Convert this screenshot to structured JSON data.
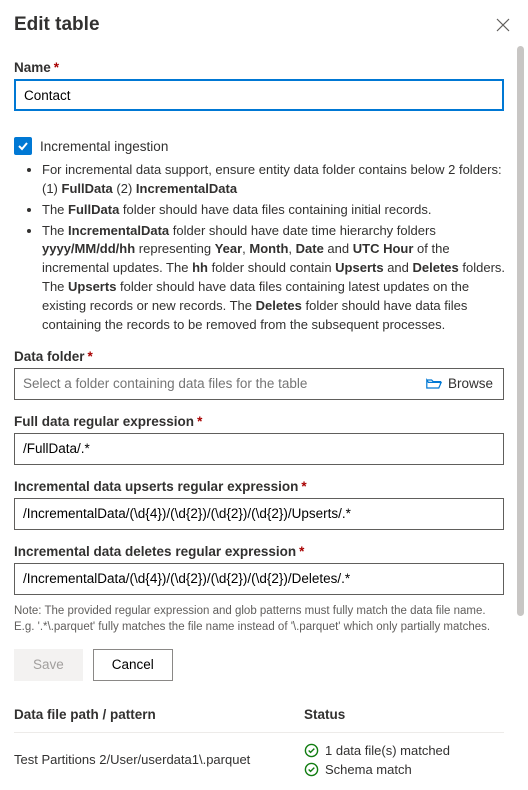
{
  "header": {
    "title": "Edit table"
  },
  "name": {
    "label": "Name",
    "value": "Contact"
  },
  "incremental": {
    "label": "Incremental ingestion",
    "bullets": [
      "For incremental data support, ensure entity data folder contains below 2 folders: (1) <b>FullData</b> (2) <b>IncrementalData</b>",
      "The <b>FullData</b> folder should have data files containing initial records.",
      "The <b>IncrementalData</b> folder should have date time hierarchy folders <b>yyyy/MM/dd/hh</b> representing <b>Year</b>, <b>Month</b>, <b>Date</b> and <b>UTC Hour</b> of the incremental updates. The <b>hh</b> folder should contain <b>Upserts</b> and <b>Deletes</b> folders. The <b>Upserts</b> folder should have data files containing latest updates on the existing records or new records. The <b>Deletes</b> folder should have data files containing the records to be removed from the subsequent processes."
    ]
  },
  "dataFolder": {
    "label": "Data folder",
    "placeholder": "Select a folder containing data files for the table",
    "browse": "Browse"
  },
  "fullRegex": {
    "label": "Full data regular expression",
    "value": "/FullData/.*"
  },
  "upRegex": {
    "label": "Incremental data upserts regular expression",
    "value": "/IncrementalData/(\\d{4})/(\\d{2})/(\\d{2})/(\\d{2})/Upserts/.*"
  },
  "delRegex": {
    "label": "Incremental data deletes regular expression",
    "value": "/IncrementalData/(\\d{4})/(\\d{2})/(\\d{2})/(\\d{2})/Deletes/.*"
  },
  "note": "Note: The provided regular expression and glob patterns must fully match the data file name. E.g. '.*\\.parquet' fully matches the file name instead of '\\.parquet' which only partially matches.",
  "buttons": {
    "save": "Save",
    "cancel": "Cancel"
  },
  "table": {
    "headers": {
      "path": "Data file path / pattern",
      "status": "Status"
    },
    "row": {
      "path": "Test Partitions 2/User/userdata1\\.parquet",
      "status1": "1 data file(s) matched",
      "status2": "Schema match"
    }
  }
}
